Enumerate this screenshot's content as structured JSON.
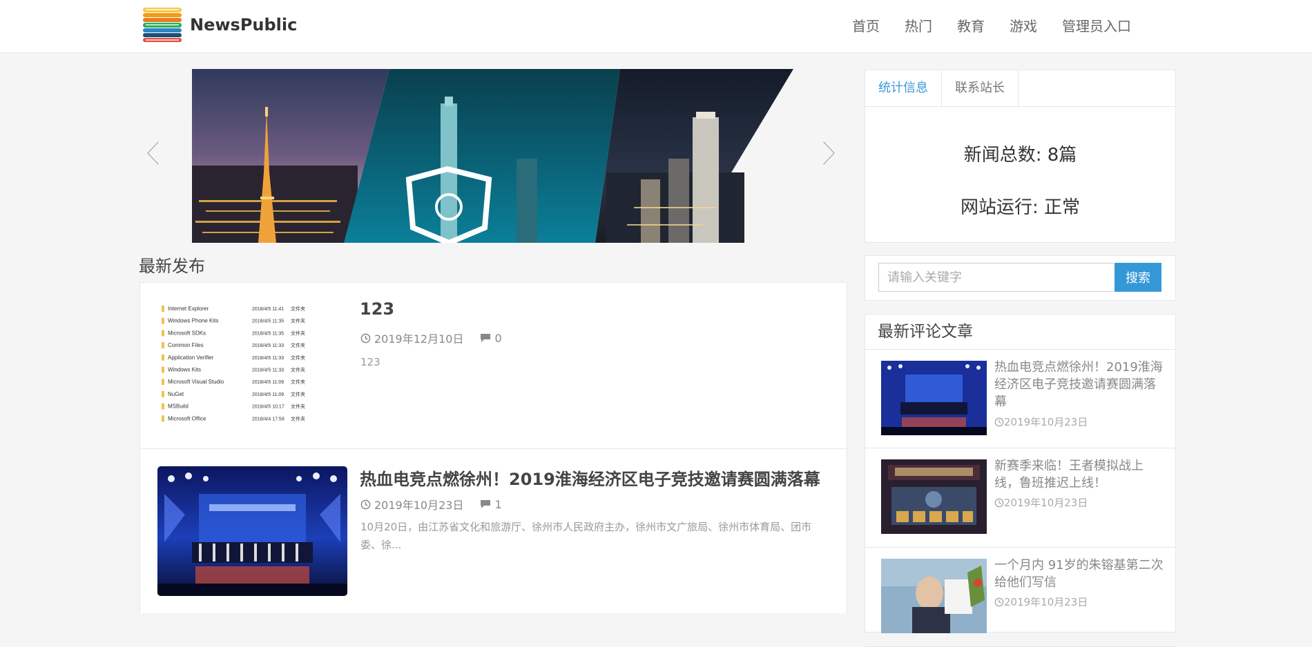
{
  "brand": {
    "name": "NewsPublic"
  },
  "nav": [
    {
      "label": "首页"
    },
    {
      "label": "热门"
    },
    {
      "label": "教育"
    },
    {
      "label": "游戏"
    },
    {
      "label": "管理员入口"
    }
  ],
  "latest": {
    "title": "最新发布",
    "posts": [
      {
        "title": "123",
        "date": "2019年12月10日",
        "comments": "0",
        "excerpt": "123",
        "thumb_rows": [
          {
            "name": "Internet Explorer",
            "date": "2018/4/5 11:41",
            "type": "文件夹"
          },
          {
            "name": "Windows Phone Kits",
            "date": "2018/4/5 11:35",
            "type": "文件夹"
          },
          {
            "name": "Microsoft SDKs",
            "date": "2018/4/5 11:35",
            "type": "文件夹"
          },
          {
            "name": "Common Files",
            "date": "2018/4/5 11:33",
            "type": "文件夹"
          },
          {
            "name": "Application Verifier",
            "date": "2018/4/5 11:33",
            "type": "文件夹"
          },
          {
            "name": "Windows Kits",
            "date": "2018/4/5 11:33",
            "type": "文件夹"
          },
          {
            "name": "Microsoft Visual Studio",
            "date": "2018/4/5 11:09",
            "type": "文件夹"
          },
          {
            "name": "NuGet",
            "date": "2018/4/5 11:09",
            "type": "文件夹"
          },
          {
            "name": "MSBuild",
            "date": "2018/4/5 10:17",
            "type": "文件夹"
          },
          {
            "name": "Microsoft Office",
            "date": "2018/4/4 17:59",
            "type": "文件夹"
          }
        ]
      },
      {
        "title": "热血电竞点燃徐州！2019淮海经济区电子竞技邀请赛圆满落幕",
        "date": "2019年10月23日",
        "comments": "1",
        "excerpt": "10月20日，由江苏省文化和旅游厅、徐州市人民政府主办，徐州市文广旅局、徐州市体育局、团市委、徐..."
      }
    ]
  },
  "stats": {
    "tabs": [
      {
        "label": "统计信息"
      },
      {
        "label": "联系站长"
      }
    ],
    "news_total": "新闻总数: 8篇",
    "site_status": "网站运行: 正常"
  },
  "search": {
    "placeholder": "请输入关键字",
    "button": "搜索"
  },
  "recent": {
    "title": "最新评论文章",
    "items": [
      {
        "title": "热血电竞点燃徐州！2019淮海经济区电子竞技邀请赛圆满落幕",
        "date": "2019年10月23日"
      },
      {
        "title": "新赛季来临！王者模拟战上线，鲁班推迟上线！",
        "date": "2019年10月23日"
      },
      {
        "title": "一个月内 91岁的朱镕基第二次给他们写信",
        "date": "2019年10月23日"
      }
    ]
  },
  "colors": {
    "accent": "#3598d6",
    "active_tab": "#3a9ad9"
  }
}
